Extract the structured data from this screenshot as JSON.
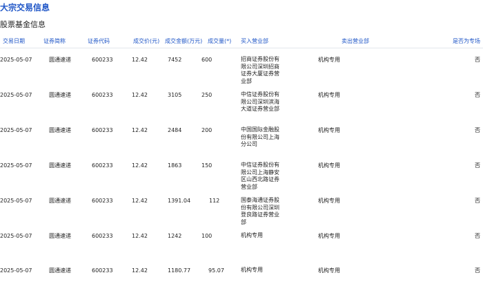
{
  "page": {
    "title": "大宗交易信息",
    "section_title": "股票基金信息"
  },
  "table": {
    "headers": {
      "date": "交易日期",
      "name": "证券简称",
      "code": "证券代码",
      "price": "成交价(元)",
      "amount": "成交金额(万元)",
      "volume": "成交量(",
      "volume_mark": "*",
      "volume_tail": ")",
      "buyer": "买入营业部",
      "seller": "卖出营业部",
      "special": "是否为专场"
    },
    "rows": [
      {
        "date": "2025-05-07",
        "name": "圆通速递",
        "code": "600233",
        "price": "12.42",
        "amount": "7452",
        "volume": "600",
        "buyer": "招商证券股份有限公司深圳招商证券大厦证券营业部",
        "seller": "机构专用",
        "special": "否"
      },
      {
        "date": "2025-05-07",
        "name": "圆通速递",
        "code": "600233",
        "price": "12.42",
        "amount": "3105",
        "volume": "250",
        "buyer": "中信证券股份有限公司深圳滨海大道证券营业部",
        "seller": "机构专用",
        "special": "否"
      },
      {
        "date": "2025-05-07",
        "name": "圆通速递",
        "code": "600233",
        "price": "12.42",
        "amount": "2484",
        "volume": "200",
        "buyer": "中国国际金融股份有限公司上海分公司",
        "seller": "机构专用",
        "special": "否"
      },
      {
        "date": "2025-05-07",
        "name": "圆通速递",
        "code": "600233",
        "price": "12.42",
        "amount": "1863",
        "volume": "150",
        "buyer": "中信证券股份有限公司上海静安区山西北路证券营业部",
        "seller": "机构专用",
        "special": "否"
      },
      {
        "date": "2025-05-07",
        "name": "圆通速递",
        "code": "600233",
        "price": "12.42",
        "amount": "1391.04",
        "volume": "112",
        "buyer": "国泰海通证券股份有限公司深圳登良路证券营业部",
        "seller": "机构专用",
        "special": "否"
      },
      {
        "date": "2025-05-07",
        "name": "圆通速递",
        "code": "600233",
        "price": "12.42",
        "amount": "1242",
        "volume": "100",
        "buyer": "机构专用",
        "seller": "机构专用",
        "special": "否"
      },
      {
        "date": "2025-05-07",
        "name": "圆通速递",
        "code": "600233",
        "price": "12.42",
        "amount": "1180.77",
        "volume": "95.07",
        "buyer": "机构专用",
        "seller": "机构专用",
        "special": "否"
      }
    ]
  }
}
